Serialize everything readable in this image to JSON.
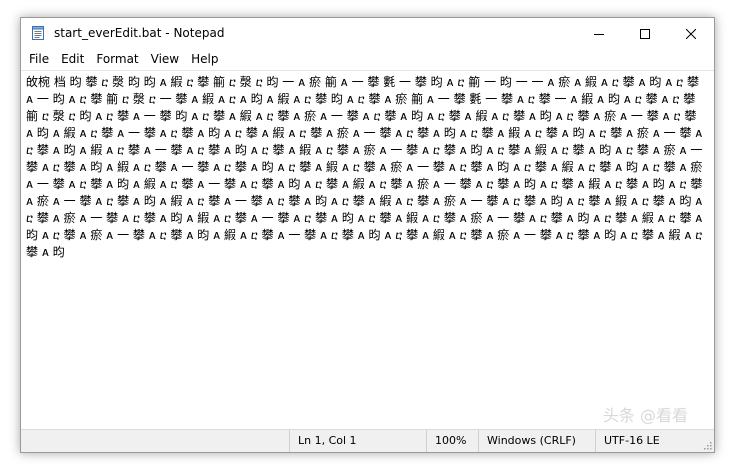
{
  "window": {
    "title": "start_everEdit.bat - Notepad",
    "controls": {
      "minimize": "minimize-icon",
      "maximize": "maximize-icon",
      "close": "close-icon"
    }
  },
  "menu": {
    "items": [
      "File",
      "Edit",
      "Format",
      "View",
      "Help"
    ]
  },
  "editor": {
    "content": "敀椀 档 昀 攀 ⴀ 漀 昀 昀 ᴀ 縀 ⴀ 攀 䈀 ⴀ 漀 ⴀ 昀 ⼀ ᴀ 瘀 䈀 ᴀ ⼀ 攀 氀 ⼀ 攀 昀 ᴀ ⴀ 䈀 ⼀ 昀 ⼀ ⼀ ᴀ 瘀 ᴀ 縀 ᴀ ⴀ 攀 ᴀ 昀 ᴀ ⴀ 攀 ᴀ ⼀ 昀 ᴀ ⴀ 攀 䈀 ⴀ 漀 ⴀ ⼀ 攀 ᴀ 縀 ᴀ ⴀ ᴀ 昀 ᴀ 縀 ᴀ ⴀ 攀 昀 ᴀ ⴀ 攀 ᴀ 瘀 䈀 ᴀ ⼀ 攀 氀 ⼀ 攀 ᴀ ⴀ 攀 ⼀ ᴀ 縀 ᴀ 昀 ᴀ ⴀ 攀 ᴀ ⴀ 攀 䈀 ⴀ 漀 ⴀ 昀 ᴀ ⴀ 攀 ᴀ ⼀ 攀 昀 ᴀ ⴀ 攀 ᴀ 縀 ᴀ ⴀ 攀 ᴀ 瘀 ᴀ ⼀ 攀 ᴀ ⴀ 攀 ᴀ 昀 ᴀ ⴀ 攀 ᴀ 縀 ᴀ ⴀ 攀 ᴀ 昀 ᴀ ⴀ 攀 ᴀ 瘀 ᴀ ⼀ 攀 ᴀ ⴀ 攀 ᴀ 昀 ᴀ 縀 ᴀ ⴀ 攀 ᴀ ⼀ 攀 ᴀ ⴀ 攀 ᴀ 昀 ᴀ ⴀ 攀 ᴀ 縀 ᴀ ⴀ 攀 ᴀ 瘀 ᴀ ⼀ 攀 ᴀ ⴀ 攀 ᴀ 昀 ᴀ ⴀ 攀 ᴀ 縀 ᴀ ⴀ 攀 ᴀ 昀 ᴀ ⴀ 攀 ᴀ 瘀 ᴀ ⼀ 攀 ᴀ ⴀ 攀 ᴀ 昀 ᴀ 縀 ᴀ ⴀ 攀 ᴀ ⼀ 攀 ᴀ ⴀ 攀 ᴀ 昀 ᴀ ⴀ 攀 ᴀ 縀 ᴀ ⴀ 攀 ᴀ 瘀 ᴀ ⼀ 攀 ᴀ ⴀ 攀 ᴀ 昀 ᴀ ⴀ 攀 ᴀ 縀 ᴀ ⴀ 攀 ᴀ 昀 ᴀ ⴀ 攀 ᴀ 瘀 ᴀ ⼀ 攀 ᴀ ⴀ 攀 ᴀ 昀 ᴀ 縀 ᴀ ⴀ 攀 ᴀ ⼀ 攀 ᴀ ⴀ 攀 ᴀ 昀 ᴀ ⴀ 攀 ᴀ 縀 ᴀ ⴀ 攀 ᴀ 瘀 ᴀ ⼀ 攀 ᴀ ⴀ 攀 ᴀ 昀 ᴀ ⴀ 攀 ᴀ 縀 ᴀ ⴀ 攀 ᴀ 昀 ᴀ ⴀ 攀 ᴀ 瘀 ᴀ ⼀ 攀 ᴀ ⴀ 攀 ᴀ 昀 ᴀ 縀 ᴀ ⴀ 攀 ᴀ ⼀ 攀 ᴀ ⴀ 攀 ᴀ 昀 ᴀ ⴀ 攀 ᴀ 縀 ᴀ ⴀ 攀 ᴀ 瘀 ᴀ ⼀ 攀 ᴀ ⴀ 攀 ᴀ 昀 ᴀ ⴀ 攀 ᴀ 縀 ᴀ ⴀ 攀 ᴀ 昀 ᴀ ⴀ 攀 ᴀ 瘀 ᴀ ⼀ 攀 ᴀ ⴀ 攀 ᴀ 昀 ᴀ 縀 ᴀ ⴀ 攀 ᴀ ⼀ 攀 ᴀ ⴀ 攀 ᴀ 昀 ᴀ ⴀ 攀 ᴀ 縀 ᴀ ⴀ 攀 ᴀ 瘀 ᴀ ⼀ 攀 ᴀ ⴀ 攀 ᴀ 昀 ᴀ ⴀ 攀 ᴀ 縀 ᴀ ⴀ 攀 ᴀ 昀 ᴀ ⴀ 攀 ᴀ 瘀 ᴀ ⼀ 攀 ᴀ ⴀ 攀 ᴀ 昀 ᴀ 縀 ᴀ ⴀ 攀 ᴀ ⼀ 攀 ᴀ ⴀ 攀 ᴀ 昀 ᴀ ⴀ 攀 ᴀ 縀 ᴀ ⴀ 攀 ᴀ 瘀 ᴀ ⼀ 攀 ᴀ ⴀ 攀 ᴀ 昀 ᴀ ⴀ 攀 ᴀ 縀 ᴀ ⴀ 攀 ᴀ 昀 ᴀ ⴀ 攀 ᴀ 瘀 ᴀ ⼀ 攀 ᴀ ⴀ 攀 ᴀ 昀 ᴀ 縀 ᴀ ⴀ 攀 ᴀ ⼀ 攀 ᴀ ⴀ 攀 ᴀ 昀 ᴀ ⴀ 攀 ᴀ 縀 ᴀ ⴀ 攀 ᴀ 瘀 ᴀ ⼀ 攀 ᴀ ⴀ 攀 ᴀ 昀 ᴀ ⴀ 攀 ᴀ 縀 ᴀ ⴀ 攀 ᴀ 昀"
  },
  "status": {
    "position": "Ln 1, Col 1",
    "zoom": "100%",
    "line_ending": "Windows (CRLF)",
    "encoding": "UTF-16 LE"
  },
  "watermark": {
    "text": "头条 @看看"
  },
  "colors": {
    "window_border": "#9a9a9a",
    "statusbar_bg": "#f0f0f0",
    "text": "#000000"
  }
}
